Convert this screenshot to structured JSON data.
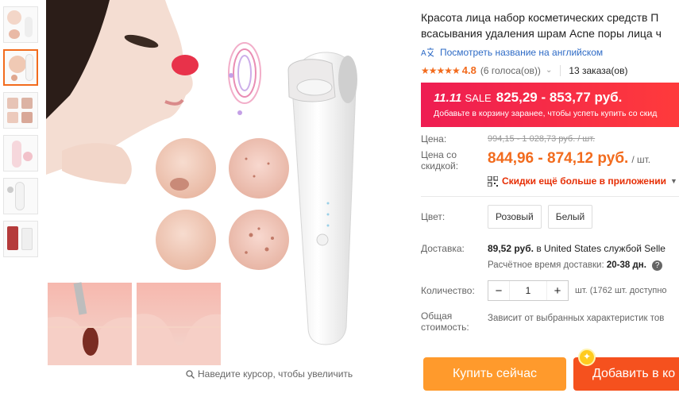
{
  "gallery": {
    "thumbnail_count": 6,
    "active_index": 1,
    "zoom_hint": "Наведите курсор, чтобы увеличить"
  },
  "product": {
    "title": "Красота лица набор косметических средств П всасывания удаления шрам Acne поры лица ч",
    "title_line1": "Красота лица набор косметических средств П",
    "title_line2": "всасывания удаления шрам Acne поры лица ч",
    "translate_link": "Посмотреть название на английском",
    "rating": "4.8",
    "votes": "(6 голоса(ов))",
    "orders": "13 заказа(ов)"
  },
  "sale": {
    "tag": "11.11",
    "tag_word": "SALE",
    "price": "825,29 - 853,77 руб.",
    "note": "Добавьте в корзину заранее, чтобы успеть купить со скид"
  },
  "pricing": {
    "price_label": "Цена:",
    "old_price": "994,15 - 1 028,73 руб. / шт.",
    "discount_label": "Цена со скидкой:",
    "discount_label_line1": "Цена со",
    "discount_label_line2": "скидкой:",
    "discount_price": "844,96 - 874,12 руб.",
    "unit": "/ шт.",
    "app_promo": "Скидки ещё больше в приложении"
  },
  "options": {
    "color_label": "Цвет:",
    "colors": [
      "Розовый",
      "Белый"
    ]
  },
  "shipping": {
    "label": "Доставка:",
    "price": "89,52 руб.",
    "destination": "в United States службой Selle",
    "time_label": "Расчётное время доставки:",
    "time": "20-38 дн."
  },
  "quantity": {
    "label": "Количество:",
    "value": "1",
    "stock": "шт. (1762 шт. доступно"
  },
  "total": {
    "label_line1": "Общая",
    "label_line2": "стоимость:",
    "value": "Зависит от выбранных характеристик тов"
  },
  "actions": {
    "buy_now": "Купить сейчас",
    "add_to_cart": "Добавить в ко"
  },
  "colors": {
    "accent": "#f26b1d",
    "sale_red": "#ee1d52",
    "buy_orange": "#ff9a2c",
    "cart_orange": "#f5511e",
    "link_blue": "#2e6bc6"
  }
}
